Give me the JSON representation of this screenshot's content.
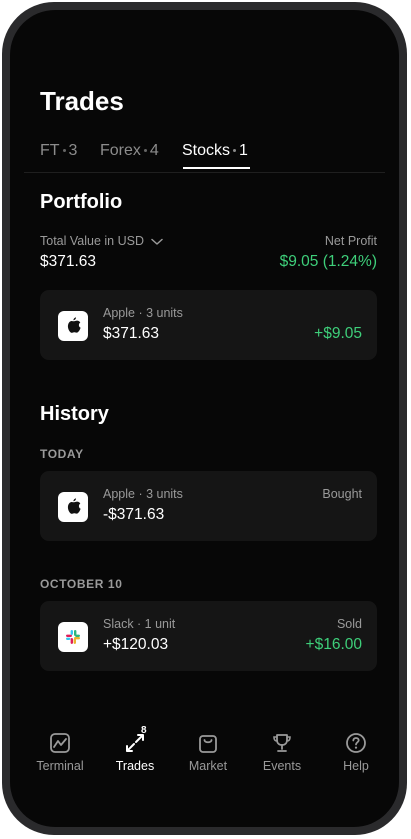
{
  "header": {
    "title": "Trades"
  },
  "tabs": [
    {
      "name": "FT",
      "count": "3"
    },
    {
      "name": "Forex",
      "count": "4"
    },
    {
      "name": "Stocks",
      "count": "1"
    }
  ],
  "portfolio": {
    "heading": "Portfolio",
    "total_label": "Total Value in USD",
    "total_value": "$371.63",
    "profit_label": "Net Profit",
    "profit_value": "$9.05 (1.24%)",
    "holding": {
      "name": "Apple · 3 units",
      "amount": "$371.63",
      "profit": "+$9.05"
    }
  },
  "history": {
    "heading": "History",
    "groups": [
      {
        "date": "TODAY",
        "item": {
          "name": "Apple · 3 units",
          "amount": "-$371.63",
          "status": "Bought",
          "change": ""
        }
      },
      {
        "date": "OCTOBER 10",
        "item": {
          "name": "Slack · 1 unit",
          "amount": "+$120.03",
          "status": "Sold",
          "change": "+$16.00"
        }
      }
    ]
  },
  "nav": {
    "items": [
      "Terminal",
      "Trades",
      "Market",
      "Events",
      "Help"
    ],
    "trades_badge": "8"
  },
  "colors": {
    "positive": "#3ecf7a",
    "background": "#070707",
    "card": "#151515"
  },
  "icons": {
    "apple": "apple-logo-icon",
    "slack": "slack-logo-icon"
  }
}
